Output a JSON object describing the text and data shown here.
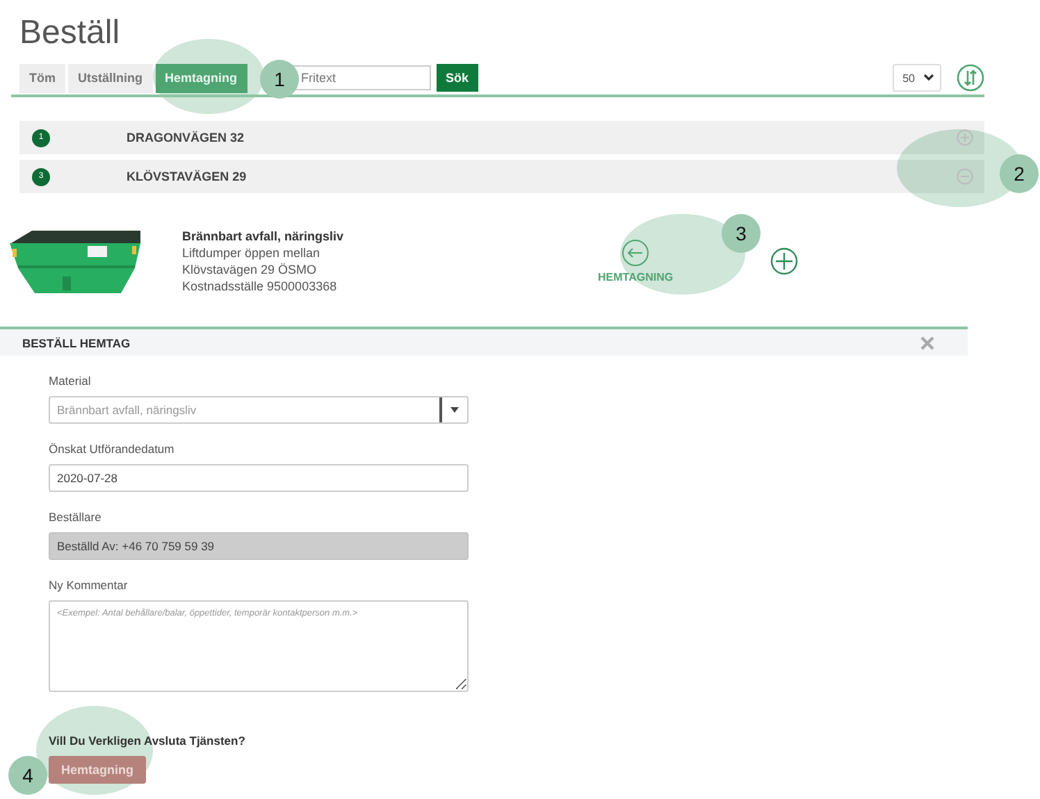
{
  "title": "Beställ",
  "tabs": [
    {
      "label": "Töm",
      "selected": false
    },
    {
      "label": "Utställning",
      "selected": false
    },
    {
      "label": "Hemtagning",
      "selected": true
    }
  ],
  "search": {
    "placeholder": "Fritext"
  },
  "search_button": "Sök",
  "page_size": "50",
  "addresses": [
    {
      "badge": "1",
      "name": "DRAGONVÄGEN 32",
      "expanded": false
    },
    {
      "badge": "3",
      "name": "KLÖVSTAVÄGEN 29",
      "expanded": true
    }
  ],
  "detail": {
    "name": "Brännbart avfall, näringsliv",
    "lines": [
      "Liftdumper öppen mellan",
      "Klövstavägen 29 ÖSMO",
      "Kostnadsställe 9500003368"
    ],
    "action": "HEMTAGNING"
  },
  "form": {
    "title": "BESTÄLL HEMTAG",
    "fields": [
      {
        "kind": "select",
        "label": "Material",
        "placeholder": "Brännbart avfall, näringsliv"
      },
      {
        "kind": "input",
        "label": "Önskat Utförandedatum",
        "value": "2020-07-28"
      },
      {
        "kind": "readonly",
        "label": "Beställare",
        "value": "Beställd Av: +46 70 759 59 39"
      },
      {
        "kind": "textarea",
        "label": "Ny Kommentar",
        "placeholder": "<Exempel: Antal behållare/balar, öppettider, temporär kontaktperson m.m.>"
      }
    ],
    "question": "Vill Du Verkligen Avsluta Tjänsten?",
    "button": "Hemtagning"
  },
  "callouts": [
    "1",
    "2",
    "3",
    "4"
  ]
}
